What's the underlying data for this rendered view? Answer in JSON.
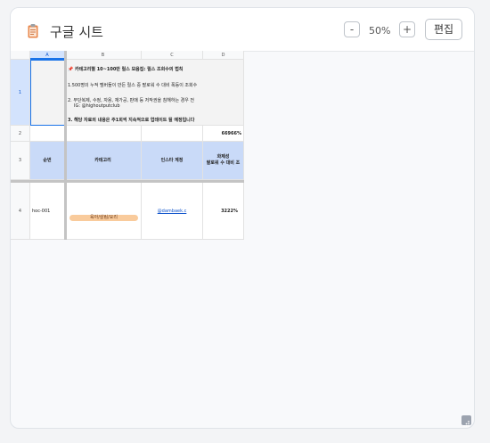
{
  "header": {
    "icon": "clipboard-icon",
    "title": "구글 시트",
    "zoom_minus": "-",
    "zoom_level": "50%",
    "zoom_plus": "+",
    "edit_label": "편집"
  },
  "sheet": {
    "columns": [
      "A",
      "B",
      "C",
      "D"
    ],
    "rows": [
      "1",
      "2",
      "3",
      "4"
    ],
    "selected_cell": "A1",
    "notes": {
      "line1": "📌 카테고리별 10~100만 릴스 모음집: 릴스 조회수의 법칙",
      "line2": "1.500명의 누적 멤버들이 만든 릴스 중 팔로워 수 대비 폭등이 조회수",
      "line3": "2. 무단복제, 수정, 자용, 재가공, 판매 등 저작권을 침해하는 경우 전",
      "line3b": "IG: @highoutputclub",
      "line4": "3. 해당 자료의 내용은 주1회씩 지속적으로 업데이트 될 예정입니다"
    },
    "row2_d": "66966%",
    "headers": {
      "a": "순번",
      "b": "카테고리",
      "c": "인스타 계정",
      "d_line1": "화제성",
      "d_line2": "팔로워 수 대비 조"
    },
    "row4": {
      "id": "hoc-001",
      "category": "육아/살림/요리",
      "account": "@dambaek.c",
      "ratio": "3222%"
    }
  },
  "colors": {
    "header_fill": "#c9daf8",
    "tag_fill": "#f9cb9c",
    "selection": "#1a73e8"
  }
}
